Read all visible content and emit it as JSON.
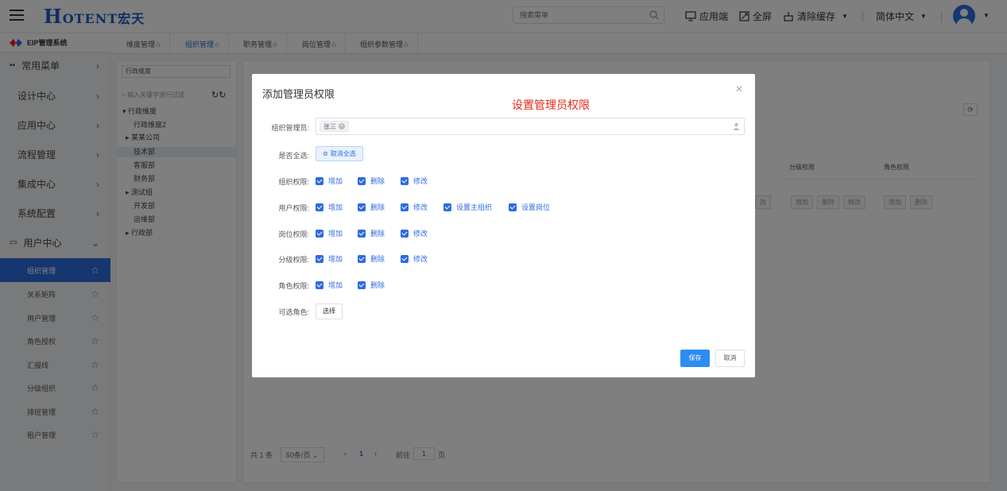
{
  "header": {
    "logo_main": "OTENT",
    "logo_h": "H",
    "logo_cn": "宏天",
    "search_placeholder": "搜索菜单",
    "app_label": "应用端",
    "fullscreen_label": "全屏",
    "clear_cache_label": "清除缓存",
    "language_label": "简体中文"
  },
  "sidebar": {
    "brand": "EIP管理系统",
    "menu": [
      "常用菜单",
      "设计中心",
      "应用中心",
      "流程管理",
      "集成中心",
      "系统配置",
      "用户中心"
    ],
    "submenu": [
      "组织管理",
      "关系矩阵",
      "用户管理",
      "角色授权",
      "汇报线",
      "分级组织",
      "排班管理",
      "租户管理"
    ]
  },
  "tabs": [
    "维度管理☆",
    "组织管理☆",
    "职务管理☆",
    "岗位管理☆",
    "组织参数管理☆"
  ],
  "left_panel": {
    "dimension_select": "行政维度",
    "filter_placeholder": "输入关键字进行过滤",
    "tree": [
      "行政维度",
      "行政维度2",
      "某某公司",
      "技术部",
      "客服部",
      "财务部",
      "测试组",
      "开发部",
      "运维部",
      "行政部"
    ]
  },
  "main_table": {
    "col_grade": "分级权限",
    "col_role": "角色权限",
    "btn_add": "增加",
    "btn_delete": "删除",
    "btn_edit": "修改",
    "btn_edit_partial": "改"
  },
  "pagination": {
    "total": "共 1 条",
    "page_size": "50条/页",
    "current_page": "1",
    "goto_prefix": "前往",
    "goto_value": "1",
    "goto_suffix": "页"
  },
  "dialog": {
    "title": "添加管理员权限",
    "annotation": "设置管理员权限",
    "admin_label": "组织管理员:",
    "admin_tag": "张三",
    "select_all_label": "是否全选:",
    "select_all_button": "取消全选",
    "org_label": "组织权限:",
    "user_label": "用户权限:",
    "post_label": "岗位权限:",
    "grade_label": "分级权限:",
    "role_label": "角色权限:",
    "roles_label": "可选角色:",
    "add": "增加",
    "delete": "删除",
    "edit": "修改",
    "set_main_org": "设置主组织",
    "set_post": "设置岗位",
    "choose_button": "选择",
    "save_button": "保存",
    "cancel_button": "取消"
  }
}
